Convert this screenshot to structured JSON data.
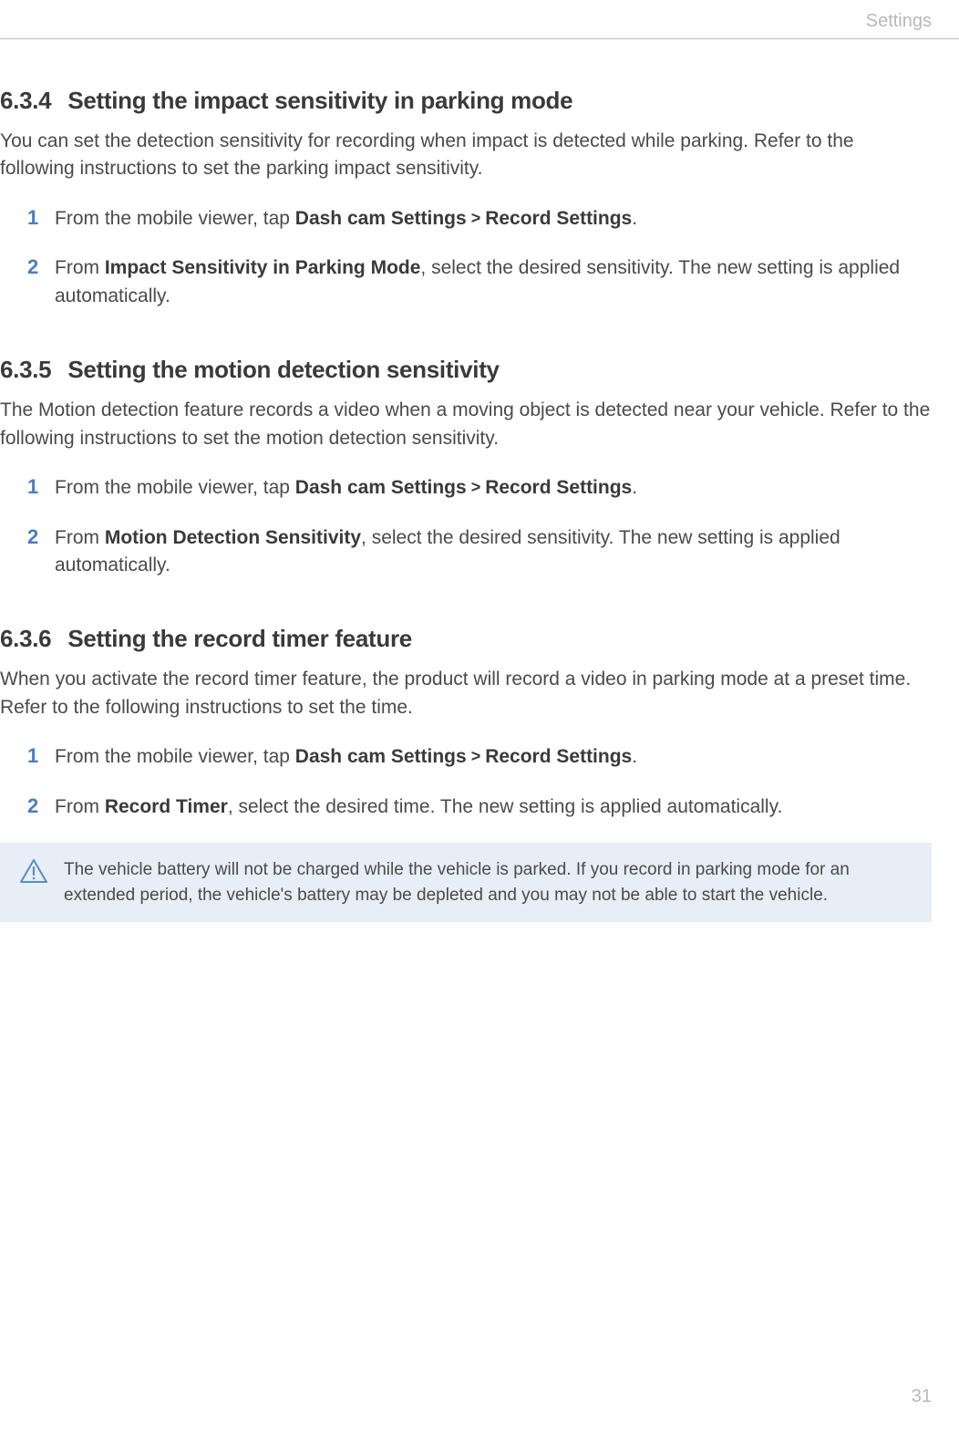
{
  "header": "Settings",
  "pageNumber": "31",
  "sections": [
    {
      "number": "6.3.4",
      "title": "Setting the impact sensitivity in parking mode",
      "intro": "You can set the detection sensitivity for recording when impact is detected while parking. Refer to the following instructions to set the parking impact sensitivity.",
      "steps": [
        {
          "num": "1",
          "pre": "From the mobile viewer, tap ",
          "bold1": "Dash cam Settings",
          "chev": " > ",
          "bold2": "Record Settings",
          "post": "."
        },
        {
          "num": "2",
          "pre": "From ",
          "bold1": "Impact Sensitivity in Parking Mode",
          "post": ", select the desired sensitivity. The new setting is applied automatically."
        }
      ]
    },
    {
      "number": "6.3.5",
      "title": "Setting the motion detection sensitivity",
      "intro": "The Motion detection feature records a video when a moving object is detected near your vehicle. Refer to the following instructions to set the motion detection sensitivity.",
      "steps": [
        {
          "num": "1",
          "pre": "From the mobile viewer, tap ",
          "bold1": "Dash cam Settings",
          "chev": " > ",
          "bold2": "Record Settings",
          "post": "."
        },
        {
          "num": "2",
          "pre": "From ",
          "bold1": "Motion Detection Sensitivity",
          "post": ", select the desired sensitivity. The new setting is applied automatically."
        }
      ]
    },
    {
      "number": "6.3.6",
      "title": "Setting the record timer feature",
      "intro": "When you activate the record timer feature, the product will record a video in parking mode at a preset time. Refer to the following instructions to set the time.",
      "steps": [
        {
          "num": "1",
          "pre": "From the mobile viewer, tap ",
          "bold1": "Dash cam Settings",
          "chev": " > ",
          "bold2": "Record Settings",
          "post": "."
        },
        {
          "num": "2",
          "pre": "From ",
          "bold1": "Record Timer",
          "post": ", select the desired time. The new setting is applied automatically."
        }
      ],
      "caution": "The vehicle battery will not be charged while the vehicle is parked. If you record in parking mode for an extended period, the vehicle's battery may be depleted and you may not be able to start the vehicle."
    }
  ]
}
